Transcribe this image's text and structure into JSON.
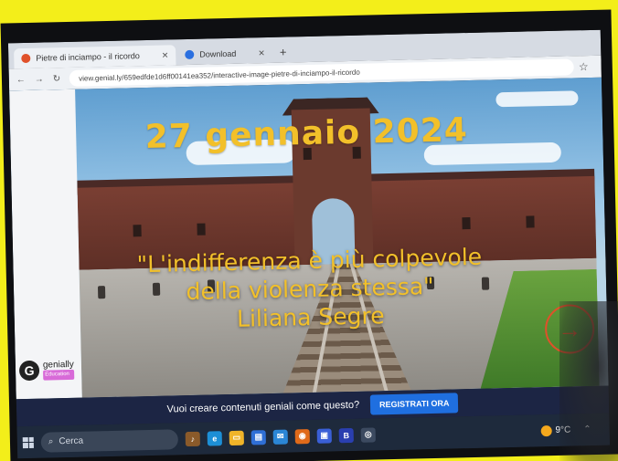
{
  "browser": {
    "tabs": [
      {
        "label": "Pietre di inciampo - il ricordo",
        "active": true
      },
      {
        "label": "Download",
        "active": false
      }
    ],
    "url": "view.genial.ly/659edfde1d6ff00141ea352/interactive-image-pietre-di-inciampo-il-ricordo"
  },
  "slide": {
    "title": "27 gennaio 2024",
    "quote_line1": "\"L'indifferenza è più colpevole",
    "quote_line2": "della violenza stessa\"",
    "author": "Liliana Segre",
    "next_arrow": "→"
  },
  "logo": {
    "name": "genially",
    "badge": "Education"
  },
  "banner": {
    "message": "Vuoi creare contenuti geniali come questo?",
    "cta": "REGISTRATI ORA"
  },
  "taskbar": {
    "search_placeholder": "Cerca",
    "temperature": "9°C"
  },
  "colors": {
    "title_yellow": "#f2c02a",
    "arrow_orange": "#e0512a",
    "cta_blue": "#1f6fe0",
    "banner_navy": "#1c2544"
  }
}
